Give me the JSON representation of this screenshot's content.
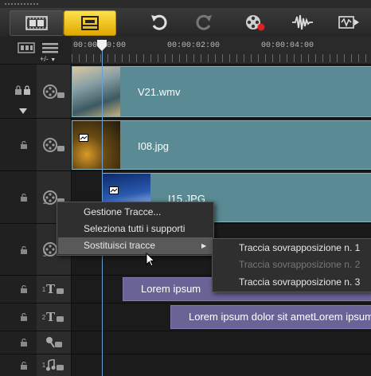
{
  "toolbar": {
    "storyboard_icon": "film-strip-icon",
    "timeline_icon": "timeline-icon",
    "undo_icon": "undo-icon",
    "redo_icon": "redo-icon",
    "record_icon": "record-capture-icon",
    "audio_icon": "audio-mixer-icon",
    "autofit_icon": "auto-music-icon",
    "active_color": "#f5c518"
  },
  "ruler": {
    "marks": [
      "00:00:00:00",
      "00:00:02:00",
      "00:00:04:00"
    ],
    "add_remove_label": "+/-"
  },
  "tracks": {
    "video": {
      "clip_name": "V21.wmv"
    },
    "overlay1": {
      "clip_name": "I08.jpg"
    },
    "overlay2": {
      "clip_name": "I15.JPG",
      "track_number": "2"
    },
    "overlay3": {
      "track_number": "3"
    },
    "title1": {
      "track_number": "1",
      "clip_text": "Lorem ipsum"
    },
    "title2": {
      "track_number": "2",
      "clip_text": "Lorem ipsum dolor sit ametLorem ipsum"
    },
    "voice": {},
    "music": {
      "track_number": "1"
    }
  },
  "context_menu": {
    "items": [
      "Gestione Tracce...",
      "Seleziona tutti i supporti",
      "Sostituisci tracce"
    ],
    "submenu_arrow": "▶"
  },
  "submenu": {
    "items": [
      "Traccia sovrapposizione n. 1",
      "Traccia sovrapposizione n. 2",
      "Traccia sovrapposizione n. 3"
    ]
  },
  "colors": {
    "clip_video": "#5a8a94",
    "clip_title": "#6a6496",
    "playhead": "#6aa0d8"
  }
}
